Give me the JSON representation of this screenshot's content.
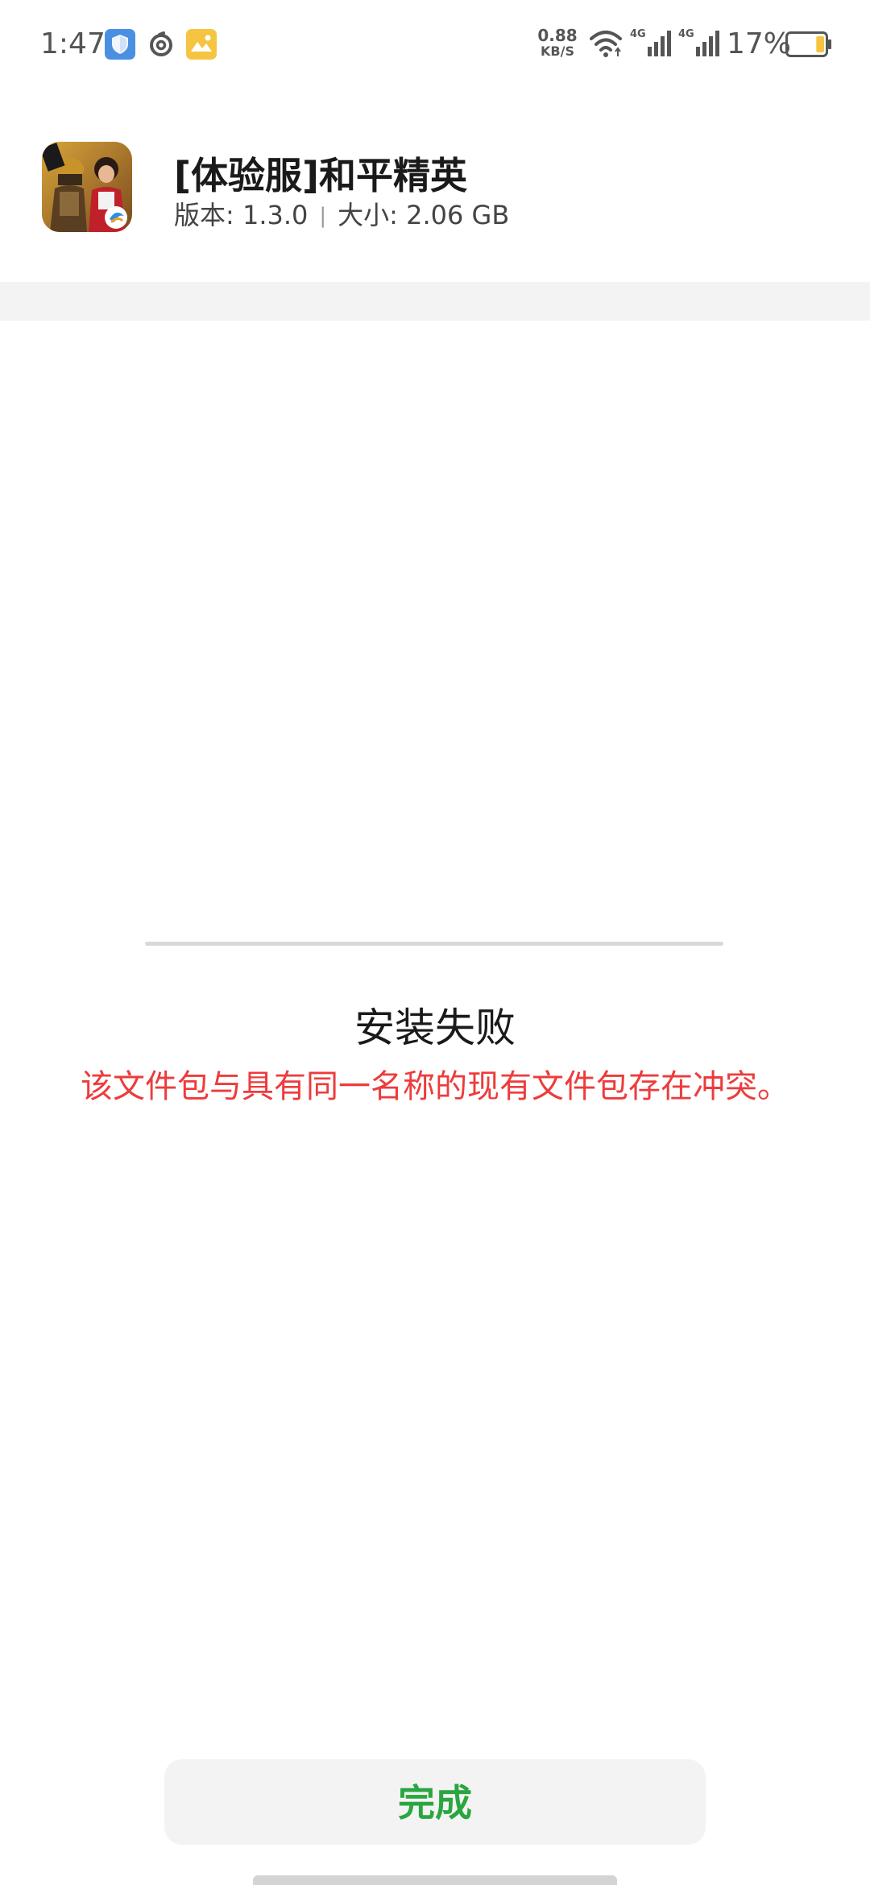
{
  "status_bar": {
    "time": "1:47",
    "net_speed_value": "0.88",
    "net_speed_unit": "KB/S",
    "sim1_label": "4G",
    "sim2_label": "4G",
    "battery_percent": "17%",
    "battery_level": 0.17,
    "icons": [
      "shield-icon",
      "netease-music-icon",
      "gallery-icon",
      "wifi-icon",
      "signal-icon",
      "signal-icon",
      "battery-icon"
    ],
    "colors": {
      "shield": "#4a90e2",
      "gallery": "#f5c542",
      "battery_fill": "#f5c542"
    }
  },
  "app": {
    "name": "[体验服]和平精英",
    "version_label": "版本: 1.3.0",
    "separator": "|",
    "size_label": "大小: 2.06 GB",
    "icon": "game-app-icon"
  },
  "result": {
    "title": "安装失败",
    "message": "该文件包与具有同一名称的现有文件包存在冲突。",
    "message_color": "#ee3b3b"
  },
  "actions": {
    "done_label": "完成",
    "done_color": "#2aa640"
  }
}
